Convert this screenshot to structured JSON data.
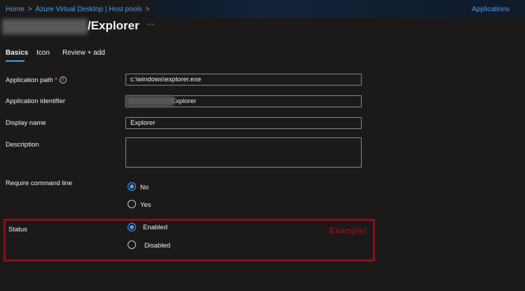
{
  "breadcrumb": {
    "items": [
      "Home",
      "Azure Virtual Desktop | Host pools"
    ],
    "right": "Applications"
  },
  "header": {
    "title": "/Explorer",
    "more": "···"
  },
  "tabs": [
    "Basics",
    "Icon",
    "Review + add"
  ],
  "form": {
    "app_path": {
      "label": "Application path",
      "required": "*",
      "value": "c:\\windows\\explorer.exe"
    },
    "app_identifier": {
      "label": "Application identifier",
      "value": "/Explorer"
    },
    "display_name": {
      "label": "Display name",
      "value": "Explorer"
    },
    "description": {
      "label": "Description",
      "value": ""
    },
    "require_cmd": {
      "label": "Require command line",
      "options": [
        "No",
        "Yes"
      ],
      "selected": "No"
    },
    "status": {
      "label": "Status",
      "options": [
        "Enabled",
        "Disabled"
      ],
      "selected": "Enabled"
    }
  },
  "annotation": {
    "text": "Example!",
    "color": "#8b0f1a"
  }
}
